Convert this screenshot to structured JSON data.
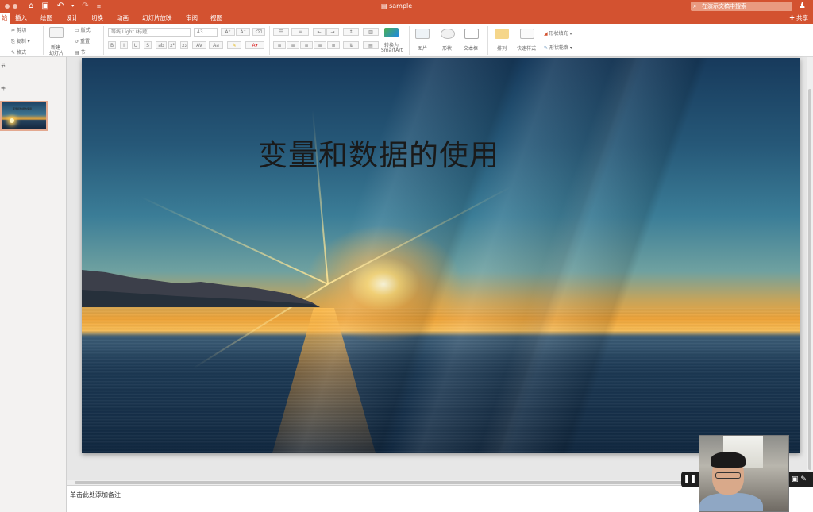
{
  "window": {
    "title": "sample",
    "search_placeholder": "在演示文稿中搜索"
  },
  "tabs": [
    {
      "label": "始"
    },
    {
      "label": "插入"
    },
    {
      "label": "绘图"
    },
    {
      "label": "设计"
    },
    {
      "label": "切换"
    },
    {
      "label": "动画"
    },
    {
      "label": "幻灯片放映"
    },
    {
      "label": "审阅"
    },
    {
      "label": "视图"
    }
  ],
  "share_label": "共享",
  "ribbon": {
    "clipboard": {
      "cut": "剪切",
      "copy": "复制",
      "format": "格式"
    },
    "slides": {
      "new_slide_line1": "新建",
      "new_slide_line2": "幻灯片",
      "layout": "版式",
      "reset": "重置",
      "section": "节"
    },
    "font": {
      "name": "等线 Light (标题)",
      "size": "43"
    },
    "paragraph": {
      "convert_line1": "转换为",
      "convert_line2": "SmartArt"
    },
    "insert": {
      "picture": "图片",
      "shape": "形状",
      "textbox": "文本框"
    },
    "drawing": {
      "arrange": "排列",
      "quick_styles": "快速样式",
      "shape_fill": "形状填充",
      "shape_outline": "形状轮廓"
    }
  },
  "left_pane": {
    "text1": "节",
    "text2": "件",
    "thumb_title": "变量和数据的使用"
  },
  "slide": {
    "title": "变量和数据的使用"
  },
  "notes": {
    "placeholder": "单击此处添加备注"
  },
  "webcam": {
    "pause_glyph": "❚❚"
  }
}
